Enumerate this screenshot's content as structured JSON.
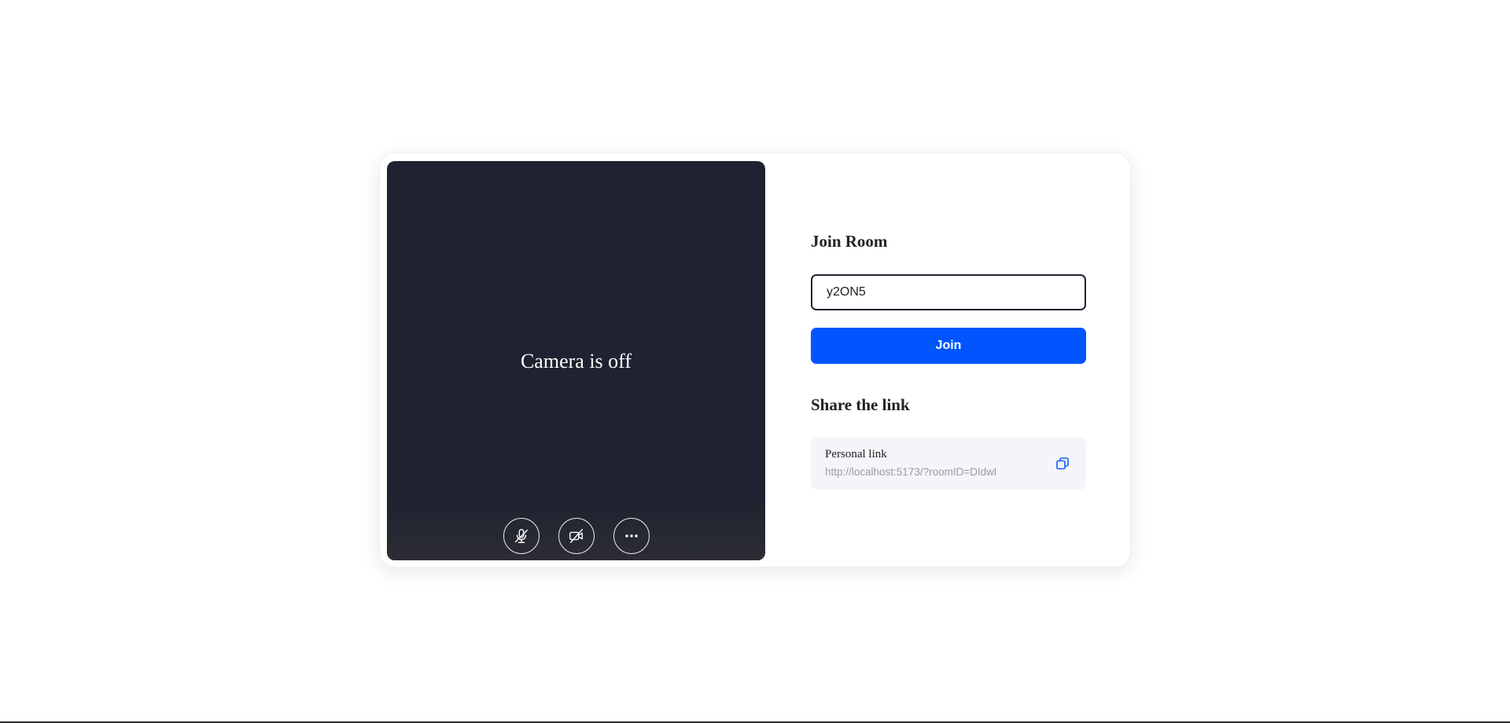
{
  "preview": {
    "camera_off_text": "Camera is off",
    "controls": [
      {
        "name": "mic-off-icon"
      },
      {
        "name": "camera-off-icon"
      },
      {
        "name": "more-icon"
      }
    ]
  },
  "join": {
    "title": "Join Room",
    "room_id_value": "y2ON5",
    "button_label": "Join"
  },
  "share": {
    "title": "Share the link",
    "link_label": "Personal link",
    "link_url": "http://localhost:5173/?roomID=DIdwl"
  },
  "colors": {
    "primary": "#0055ff",
    "preview_bg": "#1f2230",
    "link_bg": "#f3f5f8"
  }
}
